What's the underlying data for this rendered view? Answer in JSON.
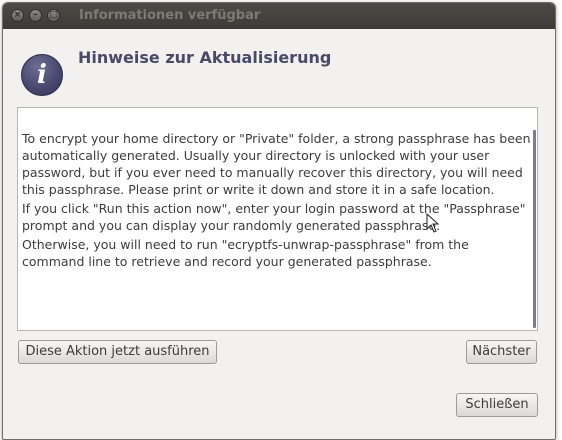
{
  "window": {
    "title": "Informationen verfügbar",
    "controls": {
      "close": "×",
      "minimize": "–",
      "maximize": "□"
    }
  },
  "header": {
    "icon": "info-icon",
    "icon_glyph": "i",
    "heading": "Hinweise zur Aktualisierung"
  },
  "content": {
    "paragraphs": [
      "To encrypt your home directory or \"Private\" folder, a strong passphrase has been automatically generated. Usually your directory is unlocked with your user password, but if you ever need to manually recover this directory, you will need this passphrase. Please print or write it down and store it in a safe location.",
      "If you click \"Run this action now\", enter your login password at the \"Passphrase\" prompt and you can display your randomly generated passphrase.",
      "Otherwise, you will need to run \"ecryptfs-unwrap-passphrase\" from the command line to retrieve and record your generated passphrase."
    ]
  },
  "buttons": {
    "run_action": "Diese Aktion jetzt ausführen",
    "next": "Nächster",
    "close": "Schließen"
  }
}
